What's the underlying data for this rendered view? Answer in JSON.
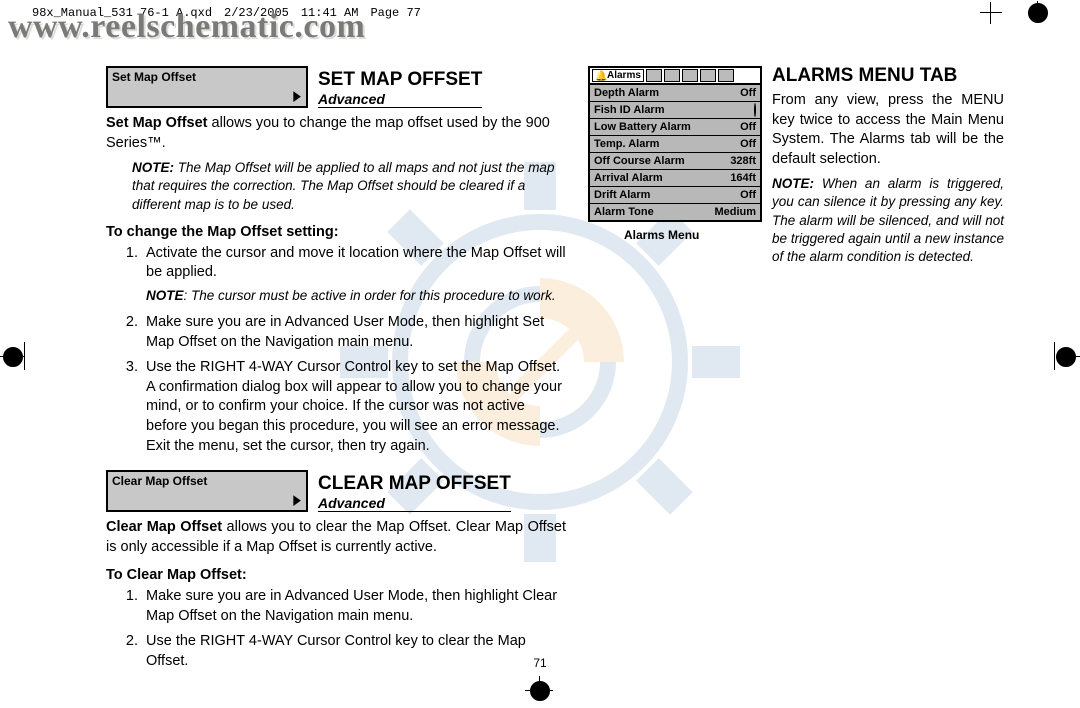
{
  "print_header": {
    "file": "98x_Manual_531 76-1 A.qxd",
    "date": "2/23/2005",
    "time": "11:41 AM",
    "page": "Page 77"
  },
  "watermark_url": "www.reelschematic.com",
  "page_number": "71",
  "left": {
    "set_map_offset": {
      "menu_box_title": "Set Map Offset",
      "arrow_glyph": "▶",
      "title": "SET MAP OFFSET",
      "subtitle": "Advanced",
      "intro_bold": "Set Map Offset",
      "intro_rest": " allows you to change the map offset used by the 900 Series™.",
      "note_label": "NOTE:",
      "note_text": " The Map Offset will be applied to all maps and not just the map that requires the correction. The Map Offset should be cleared if a different map is to be used.",
      "procedure_head": "To change the Map Offset setting:",
      "steps": [
        "Activate the cursor and move it location where the Map Offset will be applied.",
        null,
        "Make sure you are in Advanced User Mode, then highlight Set Map Offset on the Navigation main menu.",
        "Use the RIGHT 4-WAY Cursor Control key to set the Map Offset. A confirmation dialog box will appear to allow you to change your mind, or to confirm your choice. If the cursor was not active before you began this procedure, you will see an error message. Exit the menu, set the cursor, then try again."
      ],
      "step1_note_label": "NOTE",
      "step1_note_text": ": The cursor must be active in order for this procedure to work."
    },
    "clear_map_offset": {
      "menu_box_title": "Clear Map Offset",
      "arrow_glyph": "▶",
      "title": "CLEAR MAP OFFSET",
      "subtitle": "Advanced",
      "intro_bold": "Clear Map Offset",
      "intro_rest": " allows you to clear the Map Offset. Clear Map Offset is only accessible if a Map Offset is currently active.",
      "procedure_head": "To Clear Map Offset:",
      "steps": [
        "Make sure you are in Advanced User Mode, then highlight Clear Map Offset on the Navigation main menu.",
        "Use the RIGHT 4-WAY Cursor Control key to clear the Map Offset."
      ]
    }
  },
  "right": {
    "title": "ALARMS MENU TAB",
    "intro": "From any view, press the MENU key twice to access the Main Menu System. The Alarms tab will be the default selection.",
    "note_label": "NOTE:",
    "note_text": " When an alarm is triggered, you can silence it by pressing any key. The alarm will be silenced, and will not be triggered again until a new instance of the alarm condition is detected.",
    "caption": "Alarms Menu",
    "menu": {
      "tab_label": "Alarms",
      "rows": [
        {
          "label": "Depth Alarm",
          "value": "Off"
        },
        {
          "label": "Fish ID Alarm",
          "value": "__indicator__"
        },
        {
          "label": "Low Battery Alarm",
          "value": "Off"
        },
        {
          "label": "Temp. Alarm",
          "value": "Off"
        },
        {
          "label": "Off Course Alarm",
          "value": "328ft"
        },
        {
          "label": "Arrival Alarm",
          "value": "164ft"
        },
        {
          "label": "Drift Alarm",
          "value": "Off"
        },
        {
          "label": "Alarm Tone",
          "value": "Medium"
        }
      ]
    }
  }
}
